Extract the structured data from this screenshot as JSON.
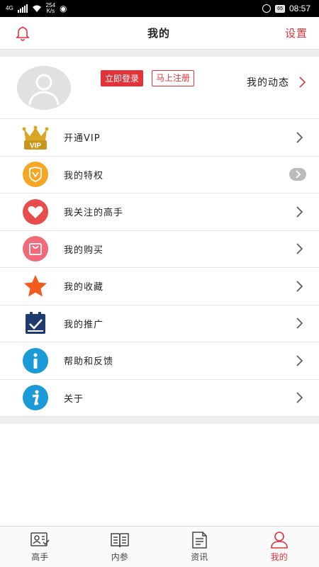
{
  "status_bar": {
    "network": "4G",
    "speed_value": "254",
    "speed_unit": "K/s",
    "battery": "65",
    "time": "08:57"
  },
  "header": {
    "title": "我的",
    "settings_label": "设置"
  },
  "profile": {
    "login_label": "立即登录",
    "register_label": "马上注册",
    "dynamic_label": "我的动态"
  },
  "menu": [
    {
      "label": "开通VIP",
      "icon": "vip-crown-icon"
    },
    {
      "label": "我的特权",
      "icon": "privilege-shield-icon"
    },
    {
      "label": "我关注的高手",
      "icon": "heart-icon"
    },
    {
      "label": "我的购买",
      "icon": "shopping-bag-icon"
    },
    {
      "label": "我的收藏",
      "icon": "star-icon"
    },
    {
      "label": "我的推广",
      "icon": "clipboard-check-icon"
    },
    {
      "label": "帮助和反馈",
      "icon": "info-icon"
    },
    {
      "label": "关于",
      "icon": "info-icon"
    }
  ],
  "vip_badge": "VIP",
  "tabs": [
    {
      "label": "高手",
      "icon": "expert-icon",
      "active": false
    },
    {
      "label": "内参",
      "icon": "book-icon",
      "active": false
    },
    {
      "label": "资讯",
      "icon": "news-icon",
      "active": false
    },
    {
      "label": "我的",
      "icon": "user-icon",
      "active": true
    }
  ],
  "colors": {
    "accent": "#e0343a",
    "vip_gold": "#d9a524",
    "privilege_orange": "#f5a623",
    "heart_red": "#e84d4d",
    "bag_pink": "#f06a7a",
    "star_orange": "#f25a1e",
    "promo_navy": "#1e3a6e",
    "info_blue": "#1a9ad6"
  }
}
